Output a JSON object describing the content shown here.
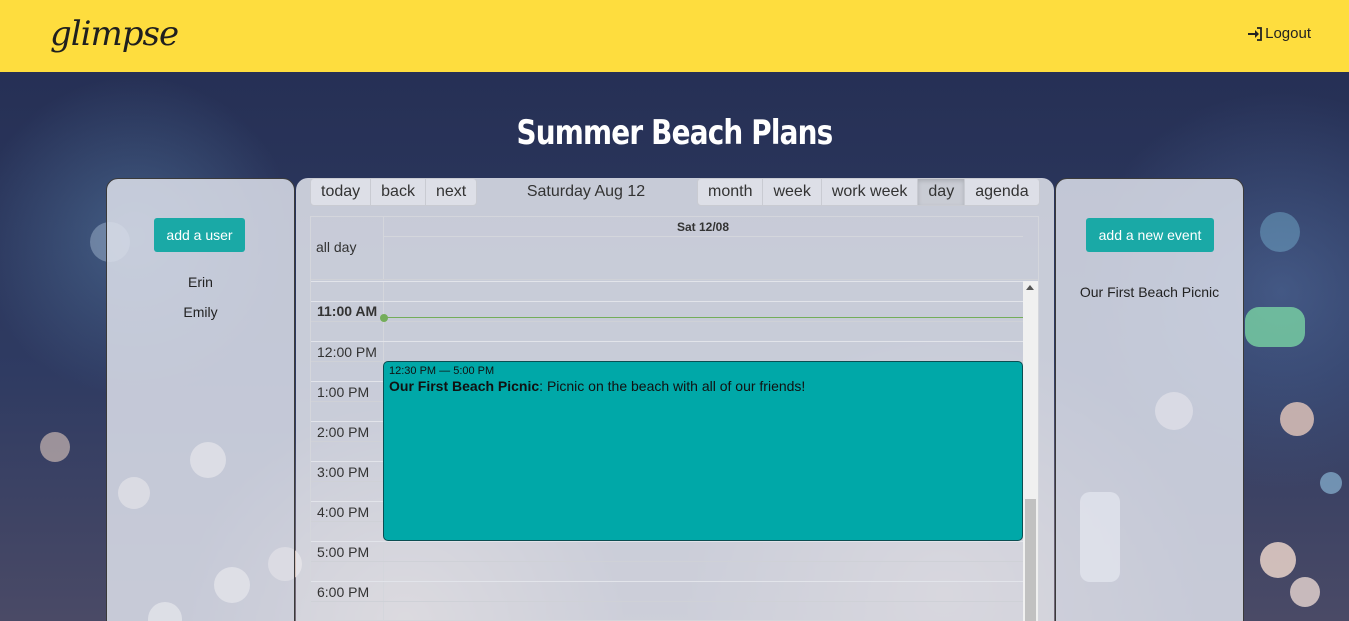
{
  "header": {
    "logo": "glimpse",
    "logout_label": "Logout"
  },
  "page_title": "Summer Beach Plans",
  "left_panel": {
    "add_user_label": "add a user",
    "users": [
      "Erin",
      "Emily"
    ]
  },
  "right_panel": {
    "add_event_label": "add a new event",
    "events": [
      "Our First Beach Picnic"
    ]
  },
  "calendar": {
    "nav": [
      "today",
      "back",
      "next"
    ],
    "label": "Saturday Aug 12",
    "views": [
      "month",
      "week",
      "work week",
      "day",
      "agenda"
    ],
    "active_view": "day",
    "day_header": "Sat 12/08",
    "all_day_label": "all day",
    "time_labels": [
      "11:00 AM",
      "12:00 PM",
      "1:00 PM",
      "2:00 PM",
      "3:00 PM",
      "4:00 PM",
      "5:00 PM",
      "6:00 PM"
    ],
    "current_time_label": "11:00 AM",
    "event": {
      "time": "12:30 PM — 5:00 PM",
      "title": "Our First Beach Picnic",
      "description": ": Picnic on the beach with all of our friends!"
    }
  },
  "colors": {
    "header_bg": "#fedd3e",
    "button_teal": "#1aa9a6",
    "event_teal": "#00a8a8",
    "now_indicator": "#74ad5a"
  }
}
